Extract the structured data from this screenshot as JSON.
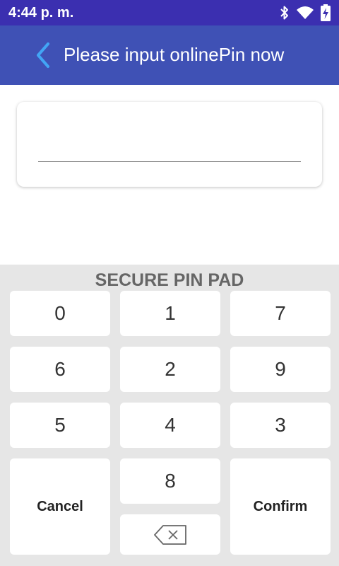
{
  "status_bar": {
    "time": "4:44 p. m.",
    "icons": [
      "bluetooth-icon",
      "wifi-icon",
      "battery-charging-icon"
    ]
  },
  "app_bar": {
    "back_icon": "chevron-left-icon",
    "title": "Please input onlinePin now"
  },
  "pin_input": {
    "value": "",
    "placeholder": ""
  },
  "pinpad": {
    "title": "SECURE PIN PAD",
    "keys": [
      "0",
      "1",
      "7",
      "6",
      "2",
      "9",
      "5",
      "4",
      "3",
      "8"
    ],
    "cancel_label": "Cancel",
    "confirm_label": "Confirm",
    "backspace_icon": "backspace-icon"
  },
  "colors": {
    "status_bar": "#3b2fb0",
    "app_bar": "#3f51b5",
    "pinpad_bg": "#e6e6e6",
    "accent_back": "#42a5f5"
  }
}
